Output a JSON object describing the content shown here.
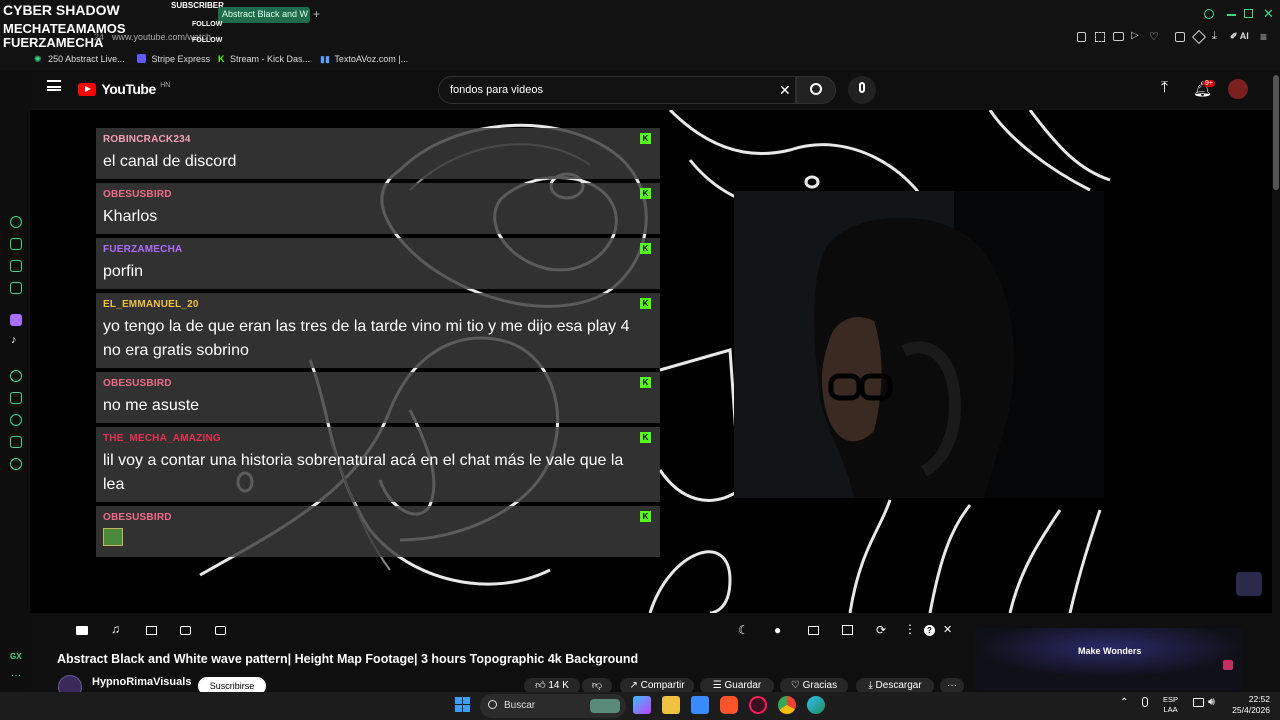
{
  "overlay": {
    "title": "CYBER SHADOW",
    "lines": [
      "MECHATEAMAMOS",
      "FUERZAMECHA"
    ],
    "badges": [
      "SUBSCRIBER",
      "FOLLOW",
      "FOLLOW"
    ]
  },
  "browser": {
    "tab_title": "Abstract Black and W",
    "new_tab": "+",
    "url": "www.youtube.com/watch",
    "url_prefix": "24",
    "ai_label": "AI",
    "bookmarks": [
      {
        "label": "250 Abstract Live...",
        "icon": "gear-icon"
      },
      {
        "label": "Stripe Express",
        "icon": "stripe-icon"
      },
      {
        "label": "Stream - Kick Das...",
        "icon": "kick-icon"
      },
      {
        "label": "TextoAVoz.com |...",
        "icon": "bars-icon"
      }
    ]
  },
  "youtube": {
    "logo": "YouTube",
    "region": "HN",
    "search_value": "fondos para videos",
    "notif_badge": "9+"
  },
  "chat": [
    {
      "user": "ROBINCRACK234",
      "color": "#f5a0b5",
      "text": "el canal de discord"
    },
    {
      "user": "OBESUSBIRD",
      "color": "#f06c8c",
      "text": "Kharlos"
    },
    {
      "user": "FUERZAMECHA",
      "color": "#b06cff",
      "text": "porfin"
    },
    {
      "user": "EL_EMMANUEL_20",
      "color": "#f0c040",
      "text": "yo tengo la de que eran las tres de la tarde vino mi tio y me dijo esa play 4 no era gratis sobrino"
    },
    {
      "user": "OBESUSBIRD",
      "color": "#f06c8c",
      "text": "no me asuste"
    },
    {
      "user": "THE_MECHA_AMAZING",
      "color": "#e83050",
      "text": "lil voy a contar una historia sobrenatural acá en el chat más le vale que la lea"
    },
    {
      "user": "OBESUSBIRD",
      "color": "#f06c8c",
      "text": ""
    }
  ],
  "video": {
    "title": "Abstract Black and White wave pattern| Height Map Footage| 3 hours Topographic 4k Background",
    "channel": "HypnoRimaVisuals",
    "subscribe": "Suscribirse",
    "likes": "14 K",
    "share": "Compartir",
    "save": "Guardar",
    "thanks": "Gracias",
    "download": "Descargar",
    "ad_text": "Make Wonders"
  },
  "taskbar": {
    "search_placeholder": "Buscar",
    "lang_top": "ESP",
    "lang_bottom": "LAA",
    "time": "22:52",
    "date": "25/4/2026"
  },
  "sidebar": {
    "bottom_label": "GX"
  },
  "colors": {
    "accent_green": "#39d98a",
    "kick_green": "#53fc18",
    "yt_red": "#ff0000"
  }
}
